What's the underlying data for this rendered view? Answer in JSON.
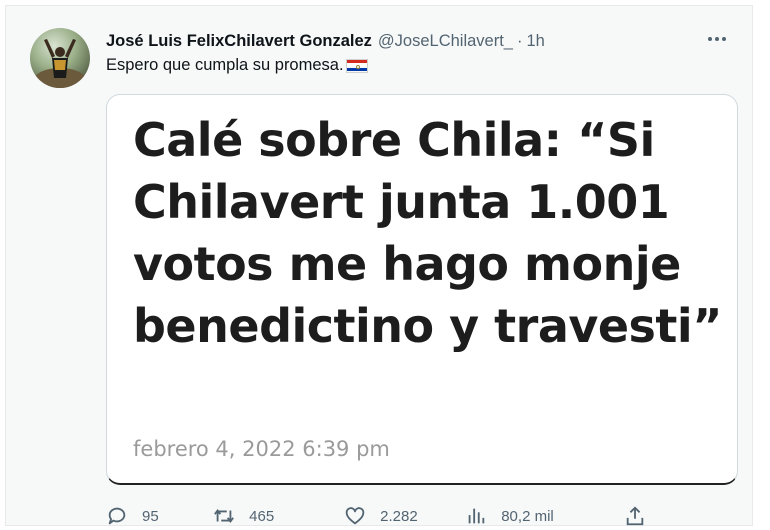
{
  "tweet": {
    "author": {
      "display_name": "José Luis FelixChilavert Gonzalez",
      "handle": "@JoseLChilavert_",
      "separator": "·",
      "time": "1h"
    },
    "text": "Espero que cumpla su promesa.",
    "flag_icon": "paraguay-flag-icon",
    "media": {
      "headline": "Calé sobre Chila: “Si Chilavert junta 1.001 votos me hago monje benedictino y travesti”",
      "date": "febrero 4, 2022 6:39 pm"
    },
    "actions": {
      "replies": "95",
      "retweets": "465",
      "likes": "2.282",
      "views": "80,2 mil"
    }
  },
  "colors": {
    "background": "#f7f9f9",
    "text": "#0f1419",
    "secondary_text": "#536471",
    "card_border": "#cfd9de"
  }
}
